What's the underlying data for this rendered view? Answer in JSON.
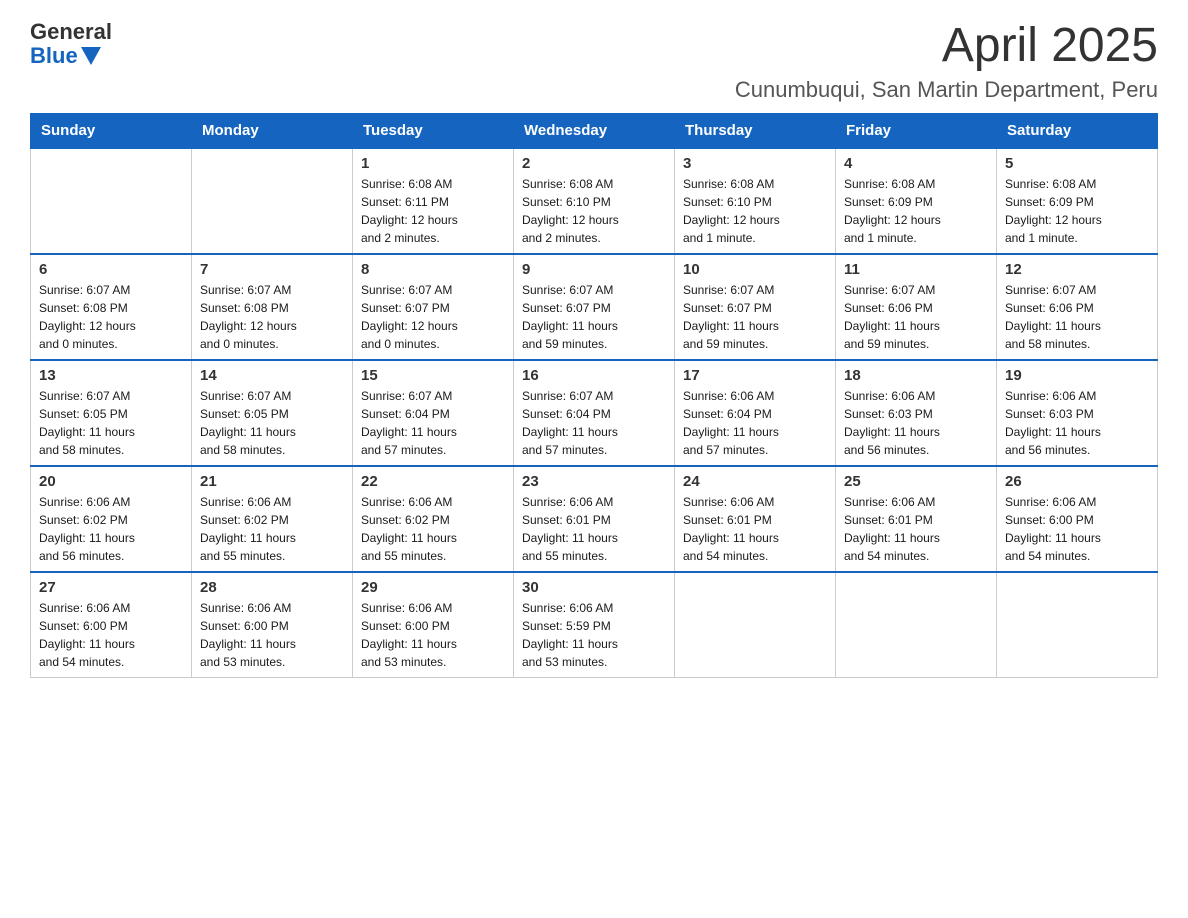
{
  "logo": {
    "general": "General",
    "blue": "Blue"
  },
  "title": "April 2025",
  "subtitle": "Cunumbuqui, San Martin Department, Peru",
  "days_of_week": [
    "Sunday",
    "Monday",
    "Tuesday",
    "Wednesday",
    "Thursday",
    "Friday",
    "Saturday"
  ],
  "weeks": [
    [
      {
        "day": "",
        "info": ""
      },
      {
        "day": "",
        "info": ""
      },
      {
        "day": "1",
        "info": "Sunrise: 6:08 AM\nSunset: 6:11 PM\nDaylight: 12 hours\nand 2 minutes."
      },
      {
        "day": "2",
        "info": "Sunrise: 6:08 AM\nSunset: 6:10 PM\nDaylight: 12 hours\nand 2 minutes."
      },
      {
        "day": "3",
        "info": "Sunrise: 6:08 AM\nSunset: 6:10 PM\nDaylight: 12 hours\nand 1 minute."
      },
      {
        "day": "4",
        "info": "Sunrise: 6:08 AM\nSunset: 6:09 PM\nDaylight: 12 hours\nand 1 minute."
      },
      {
        "day": "5",
        "info": "Sunrise: 6:08 AM\nSunset: 6:09 PM\nDaylight: 12 hours\nand 1 minute."
      }
    ],
    [
      {
        "day": "6",
        "info": "Sunrise: 6:07 AM\nSunset: 6:08 PM\nDaylight: 12 hours\nand 0 minutes."
      },
      {
        "day": "7",
        "info": "Sunrise: 6:07 AM\nSunset: 6:08 PM\nDaylight: 12 hours\nand 0 minutes."
      },
      {
        "day": "8",
        "info": "Sunrise: 6:07 AM\nSunset: 6:07 PM\nDaylight: 12 hours\nand 0 minutes."
      },
      {
        "day": "9",
        "info": "Sunrise: 6:07 AM\nSunset: 6:07 PM\nDaylight: 11 hours\nand 59 minutes."
      },
      {
        "day": "10",
        "info": "Sunrise: 6:07 AM\nSunset: 6:07 PM\nDaylight: 11 hours\nand 59 minutes."
      },
      {
        "day": "11",
        "info": "Sunrise: 6:07 AM\nSunset: 6:06 PM\nDaylight: 11 hours\nand 59 minutes."
      },
      {
        "day": "12",
        "info": "Sunrise: 6:07 AM\nSunset: 6:06 PM\nDaylight: 11 hours\nand 58 minutes."
      }
    ],
    [
      {
        "day": "13",
        "info": "Sunrise: 6:07 AM\nSunset: 6:05 PM\nDaylight: 11 hours\nand 58 minutes."
      },
      {
        "day": "14",
        "info": "Sunrise: 6:07 AM\nSunset: 6:05 PM\nDaylight: 11 hours\nand 58 minutes."
      },
      {
        "day": "15",
        "info": "Sunrise: 6:07 AM\nSunset: 6:04 PM\nDaylight: 11 hours\nand 57 minutes."
      },
      {
        "day": "16",
        "info": "Sunrise: 6:07 AM\nSunset: 6:04 PM\nDaylight: 11 hours\nand 57 minutes."
      },
      {
        "day": "17",
        "info": "Sunrise: 6:06 AM\nSunset: 6:04 PM\nDaylight: 11 hours\nand 57 minutes."
      },
      {
        "day": "18",
        "info": "Sunrise: 6:06 AM\nSunset: 6:03 PM\nDaylight: 11 hours\nand 56 minutes."
      },
      {
        "day": "19",
        "info": "Sunrise: 6:06 AM\nSunset: 6:03 PM\nDaylight: 11 hours\nand 56 minutes."
      }
    ],
    [
      {
        "day": "20",
        "info": "Sunrise: 6:06 AM\nSunset: 6:02 PM\nDaylight: 11 hours\nand 56 minutes."
      },
      {
        "day": "21",
        "info": "Sunrise: 6:06 AM\nSunset: 6:02 PM\nDaylight: 11 hours\nand 55 minutes."
      },
      {
        "day": "22",
        "info": "Sunrise: 6:06 AM\nSunset: 6:02 PM\nDaylight: 11 hours\nand 55 minutes."
      },
      {
        "day": "23",
        "info": "Sunrise: 6:06 AM\nSunset: 6:01 PM\nDaylight: 11 hours\nand 55 minutes."
      },
      {
        "day": "24",
        "info": "Sunrise: 6:06 AM\nSunset: 6:01 PM\nDaylight: 11 hours\nand 54 minutes."
      },
      {
        "day": "25",
        "info": "Sunrise: 6:06 AM\nSunset: 6:01 PM\nDaylight: 11 hours\nand 54 minutes."
      },
      {
        "day": "26",
        "info": "Sunrise: 6:06 AM\nSunset: 6:00 PM\nDaylight: 11 hours\nand 54 minutes."
      }
    ],
    [
      {
        "day": "27",
        "info": "Sunrise: 6:06 AM\nSunset: 6:00 PM\nDaylight: 11 hours\nand 54 minutes."
      },
      {
        "day": "28",
        "info": "Sunrise: 6:06 AM\nSunset: 6:00 PM\nDaylight: 11 hours\nand 53 minutes."
      },
      {
        "day": "29",
        "info": "Sunrise: 6:06 AM\nSunset: 6:00 PM\nDaylight: 11 hours\nand 53 minutes."
      },
      {
        "day": "30",
        "info": "Sunrise: 6:06 AM\nSunset: 5:59 PM\nDaylight: 11 hours\nand 53 minutes."
      },
      {
        "day": "",
        "info": ""
      },
      {
        "day": "",
        "info": ""
      },
      {
        "day": "",
        "info": ""
      }
    ]
  ]
}
